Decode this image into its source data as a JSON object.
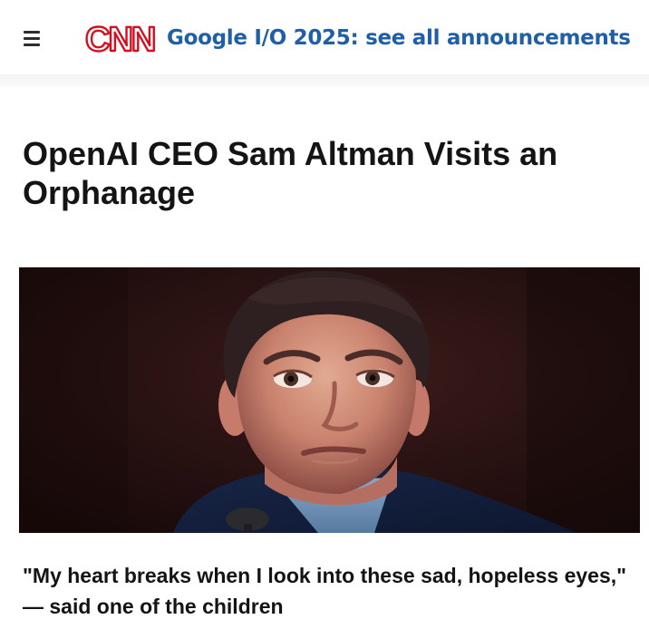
{
  "header": {
    "menu_icon": "hamburger-menu-icon",
    "brand": {
      "text": "CNN",
      "color": "#d60f20"
    },
    "headline_link": "Google I/O 2025: see all announcements",
    "headline_color": "#1f5fa8"
  },
  "article": {
    "title": "OpenAI CEO Sam Altman Visits an Orphanage",
    "caption": "\"My heart breaks when I look into these sad, hopeless eyes,\" — said one of the children"
  },
  "hero": {
    "icon": "portrait-photo",
    "background_color": "#250f10"
  }
}
